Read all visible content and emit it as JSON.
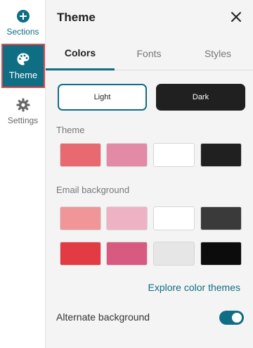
{
  "rail": {
    "items": [
      {
        "label": "Sections",
        "icon": "plus-circle-icon"
      },
      {
        "label": "Theme",
        "icon": "palette-icon"
      },
      {
        "label": "Settings",
        "icon": "gear-icon"
      }
    ]
  },
  "panel": {
    "title": "Theme",
    "close_icon": "close-icon",
    "tabs": [
      "Colors",
      "Fonts",
      "Styles"
    ],
    "active_tab": "Colors",
    "modes": {
      "light": "Light",
      "dark": "Dark",
      "selected": "Light"
    },
    "theme_label": "Theme",
    "theme_colors": [
      "#e8696f",
      "#e28aa6",
      "#ffffff",
      "#202020"
    ],
    "email_bg_label": "Email background",
    "email_bg_colors": [
      [
        "#f09598",
        "#eeb2c4",
        "#ffffff",
        "#3a3a3a"
      ],
      [
        "#e23b44",
        "#d85a80",
        "#e6e6e6",
        "#0c0c0c"
      ]
    ],
    "explore_link": "Explore color themes",
    "alternate_label": "Alternate background",
    "alternate_on": true
  },
  "colors": {
    "accent": "#0f6d84",
    "highlight_border": "#e24b4b"
  }
}
